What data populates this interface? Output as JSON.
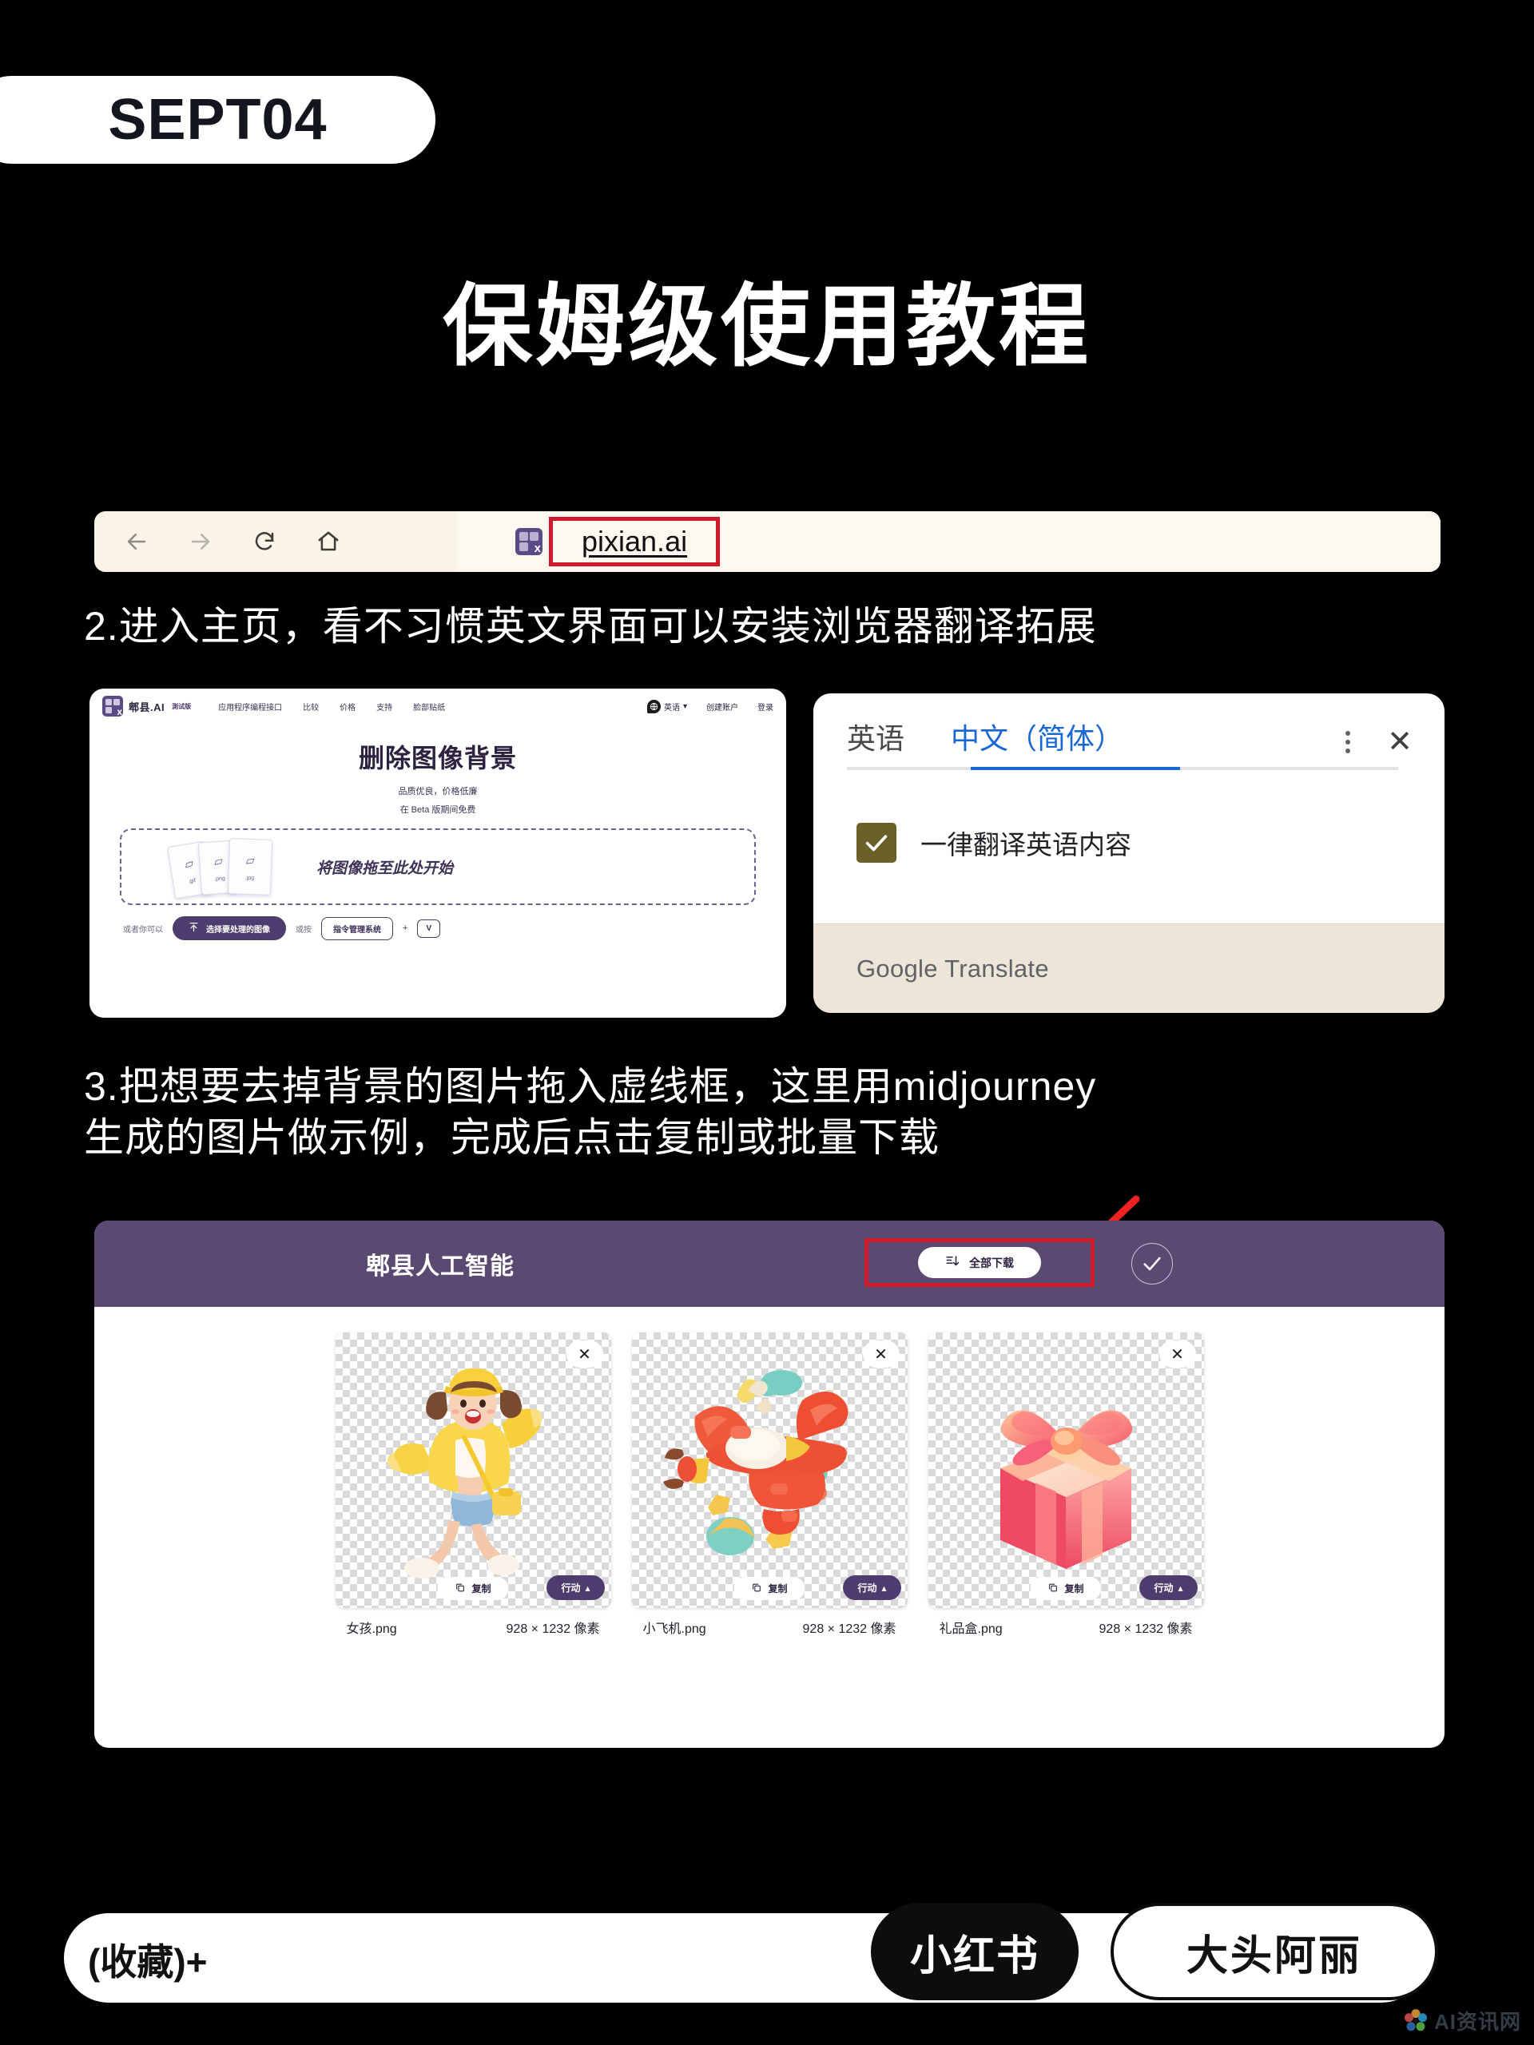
{
  "header": {
    "date_badge": "SEPT04",
    "title": "保姆级使用教程"
  },
  "browser": {
    "back_icon": "arrow-left-icon",
    "forward_icon": "arrow-right-icon",
    "reload_icon": "reload-icon",
    "home_icon": "home-icon",
    "favicon": "pixian-favicon",
    "url": "pixian.ai"
  },
  "steps": {
    "step2": "2.进入主页，看不习惯英文界面可以安装浏览器翻译拓展",
    "step3_line1": "3.把想要去掉背景的图片拖入虚线框，这里用midjourney",
    "step3_line2": "生成的图片做示例，完成后点击复制或批量下载"
  },
  "pixian": {
    "brand": "郫县.AI",
    "beta_tag": "測试版",
    "nav": [
      "应用程序编程接口",
      "比较",
      "价格",
      "支持",
      "脸部贴纸"
    ],
    "language": "英语",
    "language_caret": "▾",
    "create_account": "创建账户",
    "sign_in": "登录",
    "heading": "删除图像背景",
    "sub1": "品质优良，价格低廉",
    "sub2": "在 Beta 版期间免费",
    "dropzone_text": "将图像拖至此处开始",
    "file_types": [
      ".gif",
      ".png",
      ".jpg"
    ],
    "or_you_can": "或者你可以",
    "choose_button": "选择要处理的图像",
    "upload_icon": "upload-icon",
    "or_press": "或按",
    "command_key": "指令管理系统",
    "plus": "+",
    "v_key": "V"
  },
  "translate": {
    "tab_source": "英语",
    "tab_target": "中文（简体）",
    "more_icon": "kebab-menu-icon",
    "close_icon": "close-icon",
    "checkbox_label": "一律翻译英语内容",
    "checkbox_checked": true,
    "footer": "Google Translate",
    "accent": "#1967d2",
    "checkbox_color": "#6b6028"
  },
  "result": {
    "panel_title": "郫县人工智能",
    "download_all": "全部下载",
    "download_icon": "download-all-icon",
    "confirm_icon": "check-circle-icon",
    "highlight_color": "#cf1a2b",
    "header_color": "#5a4a72",
    "items": [
      {
        "name": "女孩.png",
        "size": "928 × 1232 像素",
        "art": "girl-yellow-jacket",
        "close_icon": "close-icon",
        "copy_label": "复制",
        "copy_icon": "copy-icon",
        "action_label": "行动",
        "action_caret": "▴"
      },
      {
        "name": "小飞机.png",
        "size": "928 × 1232 像素",
        "art": "red-toy-airplane",
        "close_icon": "close-icon",
        "copy_label": "复制",
        "copy_icon": "copy-icon",
        "action_label": "行动",
        "action_caret": "▴"
      },
      {
        "name": "礼品盒.png",
        "size": "928 × 1232 像素",
        "art": "pink-gift-box",
        "close_icon": "close-icon",
        "copy_label": "复制",
        "copy_icon": "copy-icon",
        "action_label": "行动",
        "action_caret": "▴"
      }
    ]
  },
  "footer": {
    "favorite": "(收藏)+",
    "platform": "小红书",
    "author": "大头阿丽",
    "watermark": "AI资讯网"
  }
}
